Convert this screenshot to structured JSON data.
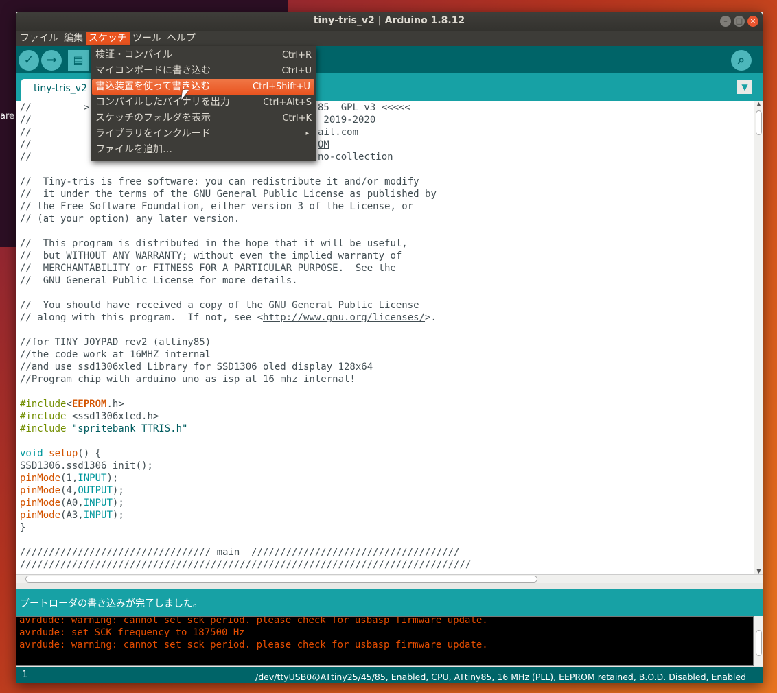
{
  "window": {
    "title": "tiny-tris_v2 | Arduino 1.8.12",
    "controls": [
      "–",
      "□",
      "×"
    ]
  },
  "desktop": {
    "side_text": "are"
  },
  "menubar": [
    {
      "label": "ファイル"
    },
    {
      "label": "編集"
    },
    {
      "label": "スケッチ"
    },
    {
      "label": "ツール"
    },
    {
      "label": "ヘルプ"
    }
  ],
  "toolbar": {
    "verify_glyph": "✓",
    "upload_glyph": "→",
    "new_glyph": "▤",
    "serial_glyph": "⌕"
  },
  "tabs": {
    "active_tab": "tiny-tris_v2",
    "menu_glyph": "▼"
  },
  "sketch_menu": {
    "items": [
      {
        "label": "検証・コンパイル",
        "shortcut": "Ctrl+R"
      },
      {
        "label": "マイコンボードに書き込む",
        "shortcut": "Ctrl+U"
      },
      {
        "label": "書込装置を使って書き込む",
        "shortcut": "Ctrl+Shift+U"
      },
      {
        "label": "コンパイルしたバイナリを出力",
        "shortcut": "Ctrl+Alt+S"
      },
      {
        "label": "スケッチのフォルダを表示",
        "shortcut": "Ctrl+K"
      },
      {
        "label": "ライブラリをインクルード",
        "shortcut": "▸"
      },
      {
        "label": "ファイルを追加…",
        "shortcut": ""
      }
    ]
  },
  "editor": {
    "lines": [
      "//         >",
      "//",
      "//",
      "//",
      "//",
      "85  GPL v3 <<<<<",
      " 2019-2020",
      "ail.com",
      "OM",
      "no-collection",
      "//  Tiny-tris is free software: you can redistribute it and/or modify",
      "//  it under the terms of the GNU General Public License as published by",
      "// the Free Software Foundation, either version 3 of the License, or",
      "// (at your option) any later version.",
      "//  This program is distributed in the hope that it will be useful,",
      "//  but WITHOUT ANY WARRANTY; without even the implied warranty of",
      "//  MERCHANTABILITY or FITNESS FOR A PARTICULAR PURPOSE.  See the",
      "//  GNU General Public License for more details.",
      "//  You should have received a copy of the GNU General Public License",
      "// along with this program.  If not, see <",
      "http://www.gnu.org/licenses/",
      ">.",
      "//for TINY JOYPAD rev2 (attiny85)",
      "//the code work at 16MHZ internal",
      "//and use ssd1306xled Library for SSD1306 oled display 128x64",
      "//Program chip with arduino uno as isp at 16 mhz internal!",
      "#include",
      "<",
      "EEPROM",
      ".h>",
      "#include",
      " <ssd1306xled.h>",
      "#include",
      " \"spritebank_TTRIS.h\"",
      "void",
      " setup",
      "() {",
      "SSD1306.ssd1306_init();",
      "pinMode",
      "(1,",
      "INPUT",
      ");",
      "pinMode",
      "(4,",
      "OUTPUT",
      ");",
      "pinMode",
      "(A0,",
      "INPUT",
      ");",
      "pinMode",
      "(A3,",
      "INPUT",
      ");",
      "}",
      "///////////////////////////////// main  ////////////////////////////////////",
      "//////////////////////////////////////////////////////////////////////////////"
    ]
  },
  "status": {
    "message": "ブートローダの書き込みが完了しました。"
  },
  "console": {
    "lines": [
      "avrdude: warning: cannot set sck period. please check for usbasp firmware update.",
      "avrdude: set SCK frequency to 187500 Hz",
      "avrdude: warning: cannot set sck period. please check for usbasp firmware update."
    ]
  },
  "footer": {
    "line_number": "1",
    "board_info": "/dev/ttyUSB0のATtiny25/45/85, Enabled, CPU, ATtiny85, 16 MHz (PLL), EEPROM retained, B.O.D. Disabled, Enabled"
  },
  "colors": {
    "accent": "#e95420",
    "arduino_dark_teal": "#006468",
    "arduino_teal": "#17a1a5",
    "console_text": "#e34c00"
  }
}
